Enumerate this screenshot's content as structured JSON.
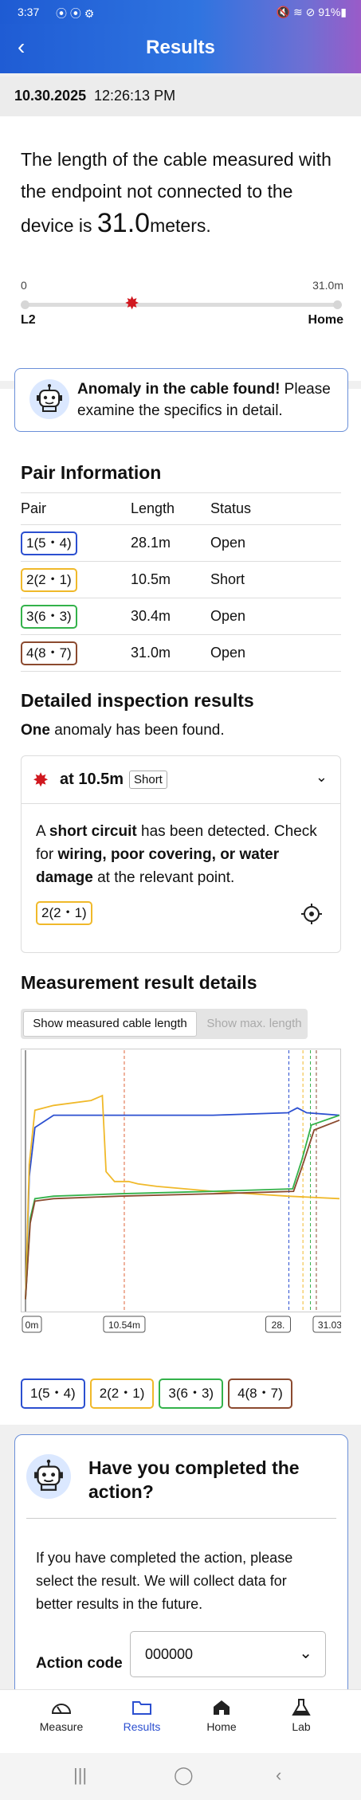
{
  "status": {
    "time": "3:37",
    "indicators": "⦿ ⦿ ⚙",
    "right": "🔇 ≋ ⊘ 91%▮"
  },
  "appbar": {
    "back_icon": "‹",
    "title": "Results"
  },
  "datebar": {
    "date": "10.30.2025",
    "time": "12:26:13 PM"
  },
  "summary": {
    "text_before": "The length of the cable measured with the endpoint not connected to the device is ",
    "value": "31.0",
    "unit": "meters."
  },
  "scale": {
    "left_value": "0",
    "right_value": "31.0m",
    "left_label": "L2",
    "right_label": "Home",
    "marker_fraction": 0.34
  },
  "alert": {
    "bold": "Anomaly in the cable found!",
    "rest": " Please examine the specifics in detail."
  },
  "pair_info": {
    "title": "Pair Information",
    "headers": [
      "Pair",
      "Length",
      "Status"
    ],
    "rows": [
      {
        "pair": "1(5・4)",
        "length": "28.1m",
        "status": "Open",
        "color": "#2b4fd0"
      },
      {
        "pair": "2(2・1)",
        "length": "10.5m",
        "status": "Short",
        "color": "#f0b92a"
      },
      {
        "pair": "3(6・3)",
        "length": "30.4m",
        "status": "Open",
        "color": "#33b24a"
      },
      {
        "pair": "4(8・7)",
        "length": "31.0m",
        "status": "Open",
        "color": "#8b4a2f"
      }
    ]
  },
  "detailed": {
    "title": "Detailed inspection results",
    "count_bold": "One",
    "count_rest": " anomaly has been found.",
    "at": "at 10.5m",
    "badge": "Short",
    "desc_a": "A ",
    "desc_b": "short circuit",
    "desc_c": " has been detected. Check for ",
    "desc_d": "wiring, poor covering, or water damage",
    "desc_e": " at the relevant point.",
    "tag": "2(2・1)"
  },
  "measurement": {
    "title": "Measurement result details",
    "toggle_on": "Show measured cable length",
    "toggle_off": "Show max. length"
  },
  "chart_data": {
    "type": "line",
    "x_range": [
      0,
      33.5
    ],
    "y_range": [
      0,
      1
    ],
    "markers": [
      {
        "label": "0m",
        "x": 0
      },
      {
        "label": "10.54m",
        "x": 10.54
      },
      {
        "label": "28.",
        "x": 28.1
      },
      {
        "label": "31.03m",
        "x": 31.03
      }
    ],
    "series": [
      {
        "name": "1(5・4)",
        "color": "#2b4fd0",
        "points": [
          [
            0,
            0.05
          ],
          [
            0.4,
            0.55
          ],
          [
            1,
            0.75
          ],
          [
            3,
            0.8
          ],
          [
            10,
            0.8
          ],
          [
            20,
            0.8
          ],
          [
            28,
            0.81
          ],
          [
            29,
            0.83
          ],
          [
            30,
            0.81
          ],
          [
            33.5,
            0.8
          ]
        ]
      },
      {
        "name": "2(2・1)",
        "color": "#f0b92a",
        "points": [
          [
            0,
            0.05
          ],
          [
            0.4,
            0.6
          ],
          [
            1,
            0.82
          ],
          [
            3,
            0.84
          ],
          [
            7,
            0.86
          ],
          [
            8.2,
            0.88
          ],
          [
            8.6,
            0.57
          ],
          [
            9.5,
            0.53
          ],
          [
            11,
            0.53
          ],
          [
            12,
            0.52
          ],
          [
            14,
            0.51
          ],
          [
            20,
            0.49
          ],
          [
            28,
            0.47
          ],
          [
            33.5,
            0.46
          ]
        ]
      },
      {
        "name": "3(6・3)",
        "color": "#33b24a",
        "points": [
          [
            0,
            0.05
          ],
          [
            0.5,
            0.38
          ],
          [
            1,
            0.46
          ],
          [
            3,
            0.47
          ],
          [
            10,
            0.48
          ],
          [
            20,
            0.49
          ],
          [
            28.5,
            0.5
          ],
          [
            29.5,
            0.62
          ],
          [
            30.5,
            0.76
          ],
          [
            33.5,
            0.8
          ]
        ]
      },
      {
        "name": "4(8・7)",
        "color": "#8b4a2f",
        "points": [
          [
            0,
            0.05
          ],
          [
            0.5,
            0.36
          ],
          [
            1,
            0.45
          ],
          [
            3,
            0.46
          ],
          [
            10,
            0.47
          ],
          [
            20,
            0.48
          ],
          [
            28.6,
            0.49
          ],
          [
            29.6,
            0.6
          ],
          [
            30.8,
            0.74
          ],
          [
            33.5,
            0.78
          ]
        ]
      }
    ]
  },
  "done": {
    "title": "Have you completed the action?",
    "text": "If you have completed the action, please select the result. We will collect data for better results in the future.",
    "action_label": "Action code",
    "action_value": "000000"
  },
  "tabs": [
    {
      "label": "Measure",
      "icon": "gauge-icon"
    },
    {
      "label": "Results",
      "icon": "folder-icon"
    },
    {
      "label": "Home",
      "icon": "home-icon"
    },
    {
      "label": "Lab",
      "icon": "flask-icon"
    }
  ],
  "navbar": {
    "recent": "|||",
    "home": "◯",
    "back": "‹"
  }
}
